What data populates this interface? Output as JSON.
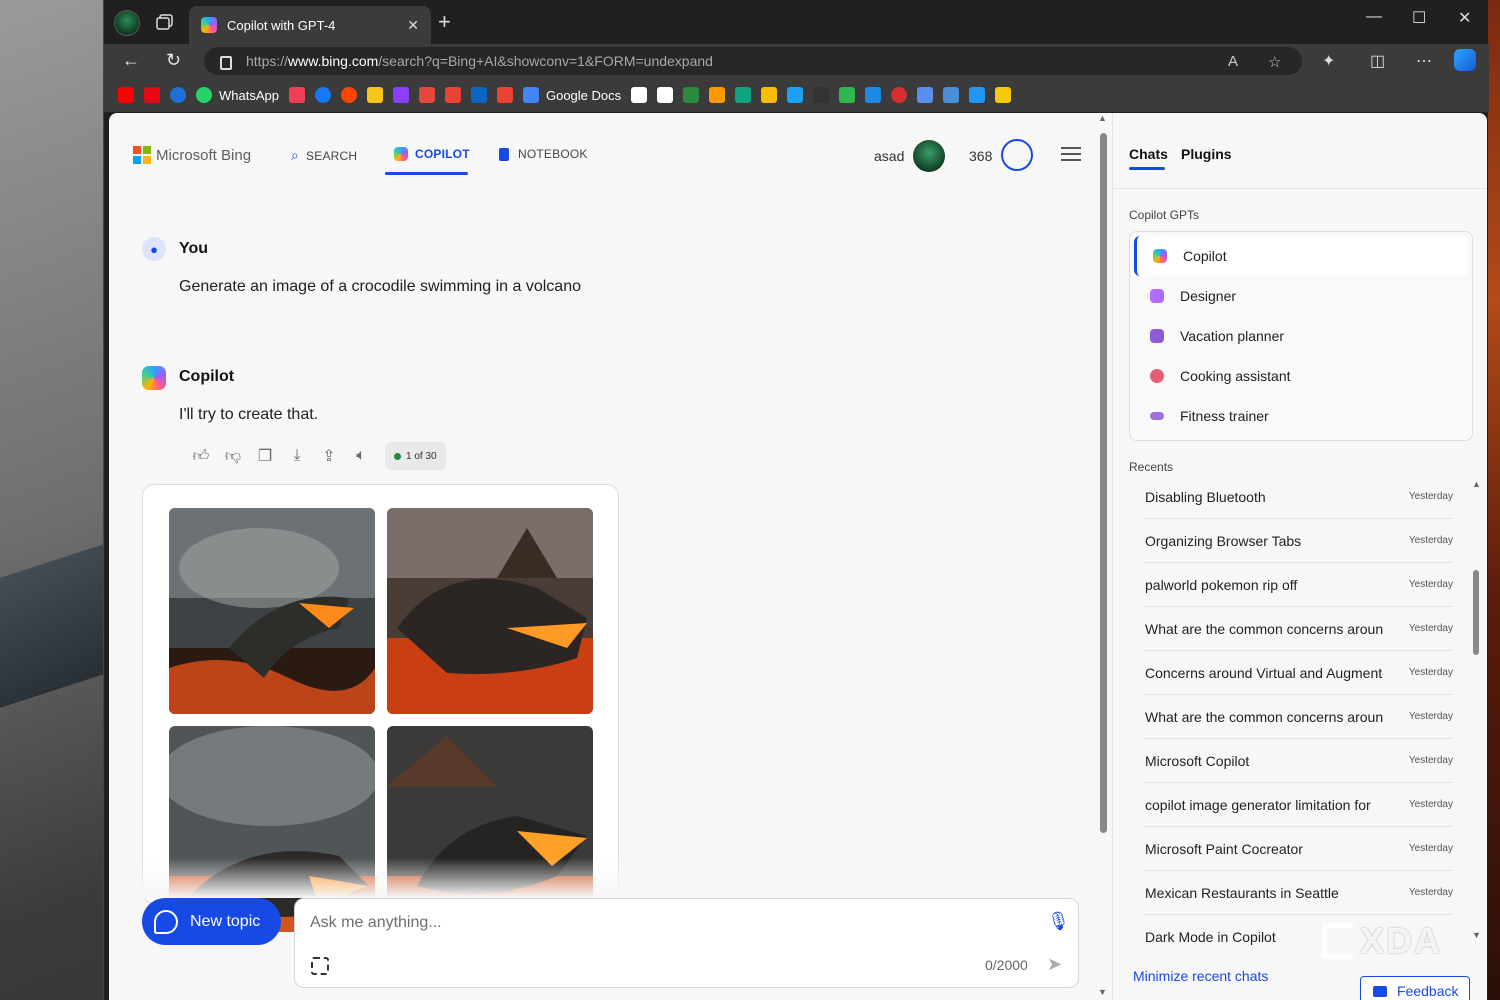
{
  "browser": {
    "tab_title": "Copilot with GPT-4",
    "url_prefix": "https://",
    "url_host": "www.bing.com",
    "url_path": "/search?q=Bing+AI&showconv=1&FORM=undexpand",
    "favorites": [
      {
        "label": "",
        "color": "#ff0000"
      },
      {
        "label": "",
        "color": "#e50914"
      },
      {
        "label": "",
        "color": "#1f6fd8"
      },
      {
        "label": "WhatsApp",
        "color": "#25d366"
      },
      {
        "label": "",
        "color": "#ef4056"
      },
      {
        "label": "",
        "color": "#1877f2"
      },
      {
        "label": "",
        "color": "#ff4500"
      },
      {
        "label": "",
        "color": "#f5c518"
      },
      {
        "label": "",
        "color": "#8a3ffc"
      },
      {
        "label": "",
        "color": "#e8453c"
      },
      {
        "label": "",
        "color": "#ea4335"
      },
      {
        "label": "",
        "color": "#0a66c2"
      },
      {
        "label": "",
        "color": "#ea4335"
      },
      {
        "label": "Google Docs",
        "color": "#4285f4"
      },
      {
        "label": "",
        "color": "#ffffff"
      },
      {
        "label": "",
        "color": "#ffffff"
      },
      {
        "label": "",
        "color": "#2b8a3e"
      },
      {
        "label": "",
        "color": "#ff9900"
      },
      {
        "label": "",
        "color": "#10a37f"
      },
      {
        "label": "",
        "color": "#fbbc04"
      },
      {
        "label": "",
        "color": "#1da1f2"
      },
      {
        "label": "",
        "color": "#333333"
      },
      {
        "label": "",
        "color": "#2eb84d"
      },
      {
        "label": "",
        "color": "#1e88e5"
      },
      {
        "label": "",
        "color": "#d32f2f"
      },
      {
        "label": "",
        "color": "#5b8def"
      },
      {
        "label": "",
        "color": "#4a90d9"
      },
      {
        "label": "",
        "color": "#2196f3"
      },
      {
        "label": "",
        "color": "#f6c90e"
      }
    ]
  },
  "header": {
    "brand": "Microsoft Bing",
    "nav": [
      {
        "label": "SEARCH"
      },
      {
        "label": "COPILOT"
      },
      {
        "label": "NOTEBOOK"
      }
    ],
    "user_name": "asad",
    "points": "368"
  },
  "conversation": {
    "user_sender": "You",
    "user_message": "Generate an image of a crocodile swimming in a volcano",
    "bot_sender": "Copilot",
    "bot_message": "I'll try to create that.",
    "turn_counter": "1 of 30"
  },
  "composer": {
    "new_topic_label": "New topic",
    "placeholder": "Ask me anything...",
    "char_count": "0/2000"
  },
  "sidebar": {
    "tabs": [
      {
        "label": "Chats"
      },
      {
        "label": "Plugins"
      }
    ],
    "gpts_heading": "Copilot GPTs",
    "gpts": [
      {
        "label": "Copilot",
        "color": "#4f8cff"
      },
      {
        "label": "Designer",
        "color": "#b26bff"
      },
      {
        "label": "Vacation planner",
        "color": "#8e5bd8"
      },
      {
        "label": "Cooking assistant",
        "color": "#e85d75"
      },
      {
        "label": "Fitness trainer",
        "color": "#a070e0"
      }
    ],
    "recents_heading": "Recents",
    "recents": [
      {
        "title": "Disabling Bluetooth",
        "time": "Yesterday"
      },
      {
        "title": "Organizing Browser Tabs",
        "time": "Yesterday"
      },
      {
        "title": "palworld pokemon rip off",
        "time": "Yesterday"
      },
      {
        "title": "What are the common concerns around",
        "time": "Yesterday"
      },
      {
        "title": "Concerns around Virtual and Augmented",
        "time": "Yesterday"
      },
      {
        "title": "What are the common concerns around",
        "time": "Yesterday"
      },
      {
        "title": "Microsoft Copilot",
        "time": "Yesterday"
      },
      {
        "title": "copilot image generator limitation for",
        "time": "Yesterday"
      },
      {
        "title": "Microsoft Paint Cocreator",
        "time": "Yesterday"
      },
      {
        "title": "Mexican Restaurants in Seattle",
        "time": "Yesterday"
      },
      {
        "title": "Dark Mode in Copilot",
        "time": ""
      }
    ],
    "minimize_label": "Minimize recent chats",
    "feedback_label": "Feedback"
  },
  "watermark": "XDA"
}
